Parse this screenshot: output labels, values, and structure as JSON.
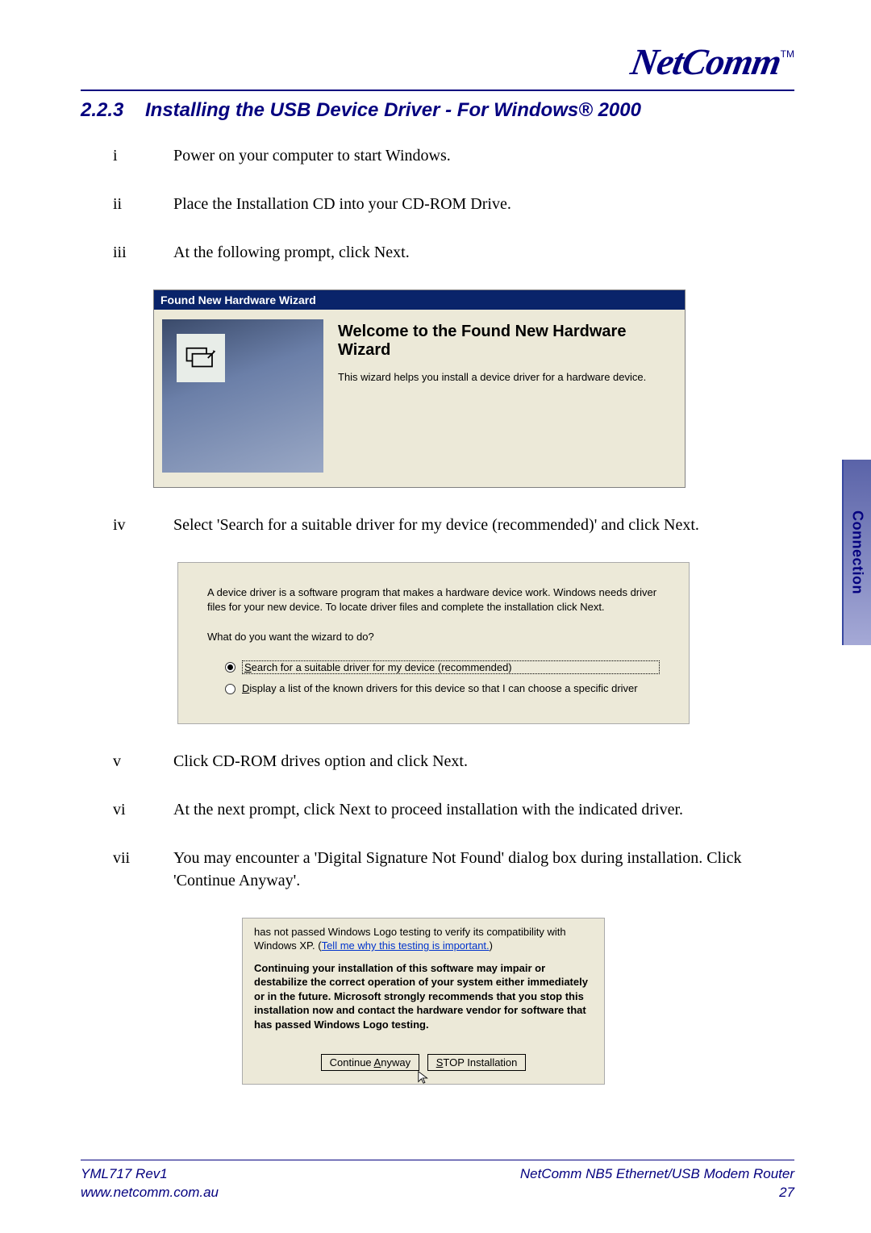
{
  "brand": {
    "name": "NetComm",
    "tm": "TM"
  },
  "section": {
    "num": "2.2.3",
    "title": "Installing the USB Device Driver - For Windows® 2000"
  },
  "steps": {
    "i": {
      "num": "i",
      "text": "Power on your computer to start Windows."
    },
    "ii": {
      "num": "ii",
      "text": "Place the Installation CD into your CD-ROM Drive."
    },
    "iii": {
      "num": "iii",
      "text": "At the following prompt, click Next."
    },
    "iv": {
      "num": "iv",
      "text": "Select 'Search for a suitable driver for my device (recommended)' and click Next."
    },
    "v": {
      "num": "v",
      "text": "Click CD-ROM drives option and click Next."
    },
    "vi": {
      "num": "vi",
      "text": "At the next prompt, click Next to proceed installation with the indicated driver."
    },
    "vii": {
      "num": "vii",
      "text": "You may encounter a 'Digital Signature Not Found' dialog box during installation. Click 'Continue Anyway'."
    }
  },
  "wiz1": {
    "title": "Found New Hardware Wizard",
    "heading": "Welcome to the Found New Hardware Wizard",
    "body": "This wizard helps you install a device driver for a hardware device."
  },
  "wiz2": {
    "intro": "A device driver is a software program that makes a hardware device work. Windows needs driver files for your new device. To locate driver files and complete the installation click Next.",
    "question": "What do you want the wizard to do?",
    "opt1_pre": "S",
    "opt1_rest": "earch for a suitable driver for my device (recommended)",
    "opt2_pre": "D",
    "opt2_rest": "isplay a list of the known drivers for this device so that I can choose a specific driver"
  },
  "wiz3": {
    "line1": "has not passed Windows Logo testing to verify its compatibility with Windows XP. (",
    "link": "Tell me why this testing is important.",
    "line1b": ")",
    "bold": "Continuing your installation of this software may impair or destabilize the correct operation of your system either immediately or in the future. Microsoft strongly recommends that you stop this installation now and contact the hardware vendor for software that has passed Windows Logo testing.",
    "btn1_pre": "Continue ",
    "btn1_u": "A",
    "btn1_rest": "nyway",
    "btn2_pre": "S",
    "btn2_rest": "TOP Installation"
  },
  "side_tab": "Connection",
  "footer": {
    "left1": "YML717 Rev1",
    "left2": "www.netcomm.com.au",
    "right1": "NetComm NB5 Ethernet/USB Modem Router",
    "right2": "27"
  }
}
